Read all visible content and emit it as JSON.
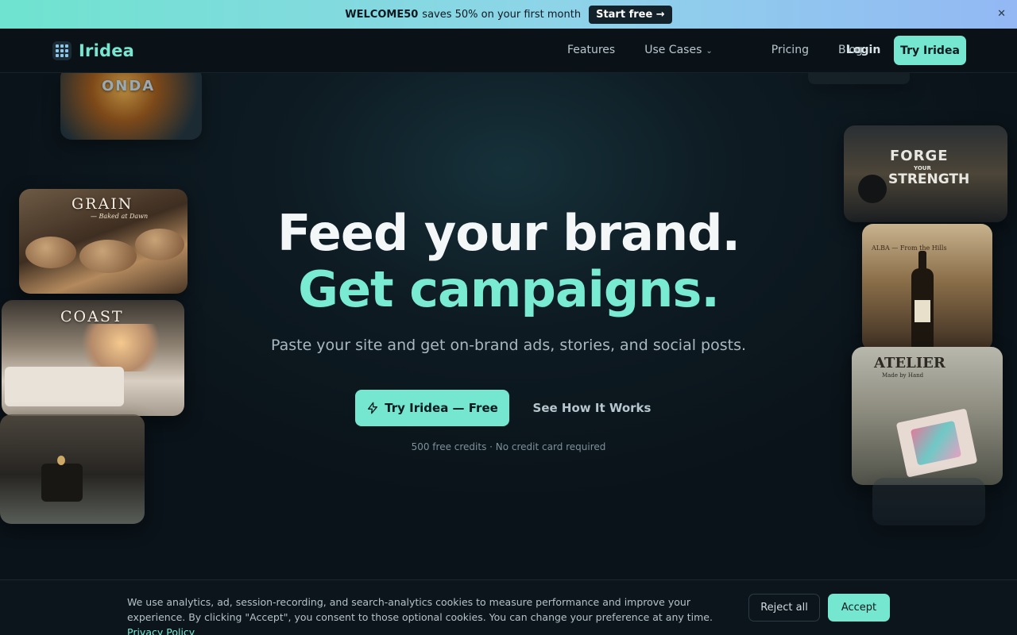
{
  "promo": {
    "code": "WELCOME50",
    "text": "saves 50% on your first month",
    "button": "Start free →",
    "close": "✕"
  },
  "nav": {
    "brand": "Iridea",
    "links": [
      "Features",
      "Use Cases",
      "Pricing",
      "Blog"
    ],
    "login": "Login",
    "cta": "Try Iridea"
  },
  "hero": {
    "headline_1": "Feed your brand.",
    "headline_2": "Get campaigns.",
    "subtitle": "Paste your site and get on-brand ads, stories, and social posts.",
    "primary_cta": "Try Iridea — Free",
    "secondary_cta": "See How It Works",
    "fine_print": "500 free credits · No credit card required"
  },
  "gallery": {
    "onda": "ONDA",
    "grain_title": "GRAIN",
    "grain_tag": "— Baked at Dawn",
    "coast": "COAST",
    "forge_1": "FORGE",
    "forge_2": "YOUR",
    "forge_3": "STRENGTH",
    "alba": "ALBA — From the Hills",
    "atelier": "ATELIER",
    "atelier_tag": "Made by Hand"
  },
  "cookie": {
    "text": "We use analytics, ad, session-recording, and search-analytics cookies to measure performance and improve your experience. By clicking \"Accept\", you consent to those optional cookies. You can change your preference at any time.",
    "link": "Privacy Policy",
    "reject": "Reject all",
    "accept": "Accept"
  },
  "colors": {
    "accent": "#75e6d0",
    "background": "#0b141b",
    "banner_start": "#6fe3cf",
    "banner_end": "#93b8f4"
  }
}
